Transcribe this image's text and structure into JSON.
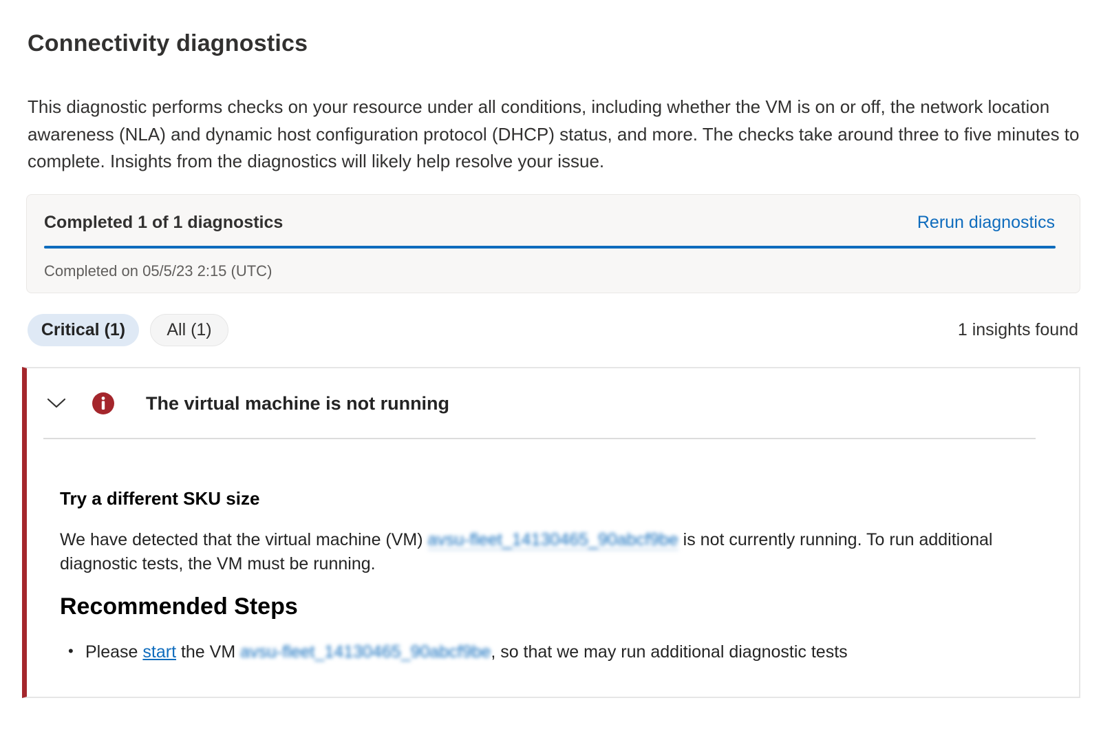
{
  "page": {
    "title": "Connectivity diagnostics",
    "description": "This diagnostic performs checks on your resource under all conditions, including whether the VM is on or off, the network location awareness (NLA) and dynamic host configuration protocol (DHCP) status, and more. The checks take around three to five minutes to complete. Insights from the diagnostics will likely help resolve your issue."
  },
  "progress": {
    "label": "Completed 1 of 1 diagnostics",
    "rerun_label": "Rerun diagnostics",
    "completed_on": "Completed on 05/5/23 2:15 (UTC)",
    "fraction": 1.0
  },
  "filters": {
    "critical_label": "Critical (1)",
    "all_label": "All (1)",
    "insights_found": "1 insights found"
  },
  "insight": {
    "severity": "critical",
    "title": "The virtual machine is not running",
    "section_heading": "Try a different SKU size",
    "detail_prefix": "We have detected that the virtual machine (VM) ",
    "vm_name": "avsu-fleet_14130465_90abcf9be",
    "detail_suffix": " is not currently running. To run additional diagnostic tests, the VM must be running.",
    "steps_heading": "Recommended Steps",
    "step_prefix": "Please ",
    "step_link": "start",
    "step_middle": " the VM ",
    "step_suffix": ", so that we may run additional diagnostic tests"
  },
  "colors": {
    "accent": "#0f6cbd",
    "critical": "#a4262c"
  }
}
